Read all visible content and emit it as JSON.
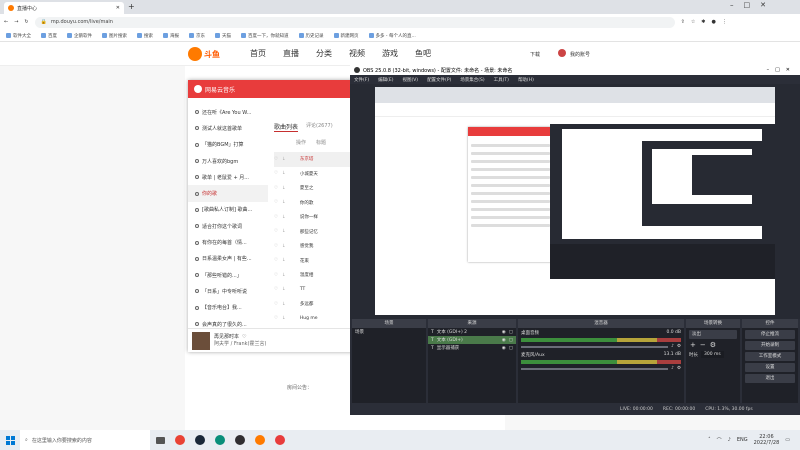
{
  "browser": {
    "tab_title": "直播中心",
    "url": "mp.douyu.com/live/main",
    "bookmarks": [
      "软件大全",
      "百度",
      "企鹅软件",
      "图片搜索",
      "搜索",
      "海报",
      "京东",
      "天猫",
      "百度一下，你就知道",
      "历史记录",
      "新建网页",
      "多多 - 每个人的直..."
    ]
  },
  "douyu": {
    "logo_text": "斗鱼",
    "nav": [
      "首页",
      "直播",
      "分类",
      "视频",
      "游戏",
      "鱼吧"
    ],
    "download": "下载",
    "user": "我的账号"
  },
  "netease": {
    "title": "网易云音乐",
    "playlists": [
      "还在听《Are You W...",
      "测试人就这首歌单",
      "「猫的BGM」打算",
      "万人喜欢的bgm",
      "歌单 | 老鼠爱 + 月...",
      "你的歌",
      "[歌曲私人订制] 歌曲...",
      "适合打你这个歌词",
      "有你在的每首（情...",
      "日系温柔女声 | 有些...",
      "「那些听错的...」",
      "「日系」中专听听说",
      "【音乐电台】我...",
      "会声真的了很久的..."
    ],
    "selected_index": 5,
    "list_tab": "歌曲列表",
    "comment_tab": "评论(2677)",
    "col_action": "操作",
    "col_title": "标题",
    "song_titles": [
      "东京塔",
      "小城夏天",
      "夏至之",
      "你的歌",
      "说你一样",
      "那些记忆",
      "感觉我",
      "花束",
      "温度相",
      "TT",
      "多远都",
      "Hug me"
    ],
    "now_playing": "再见那时本",
    "now_artist": "阿夫学 / Frank(霍兰言)"
  },
  "obs": {
    "title": "OBS 25.0.8 (32-bit, windows) - 配置文件: 未命名 - 场景: 未命名",
    "menu": [
      "文件(F)",
      "编辑(E)",
      "视图(V)",
      "配置文件(P)",
      "场景集合(S)",
      "工具(T)",
      "帮助(H)"
    ],
    "docks": {
      "scenes": "场景",
      "sources": "来源",
      "mixer": "混音器",
      "transitions": "场景转换",
      "controls": "控件"
    },
    "scene_item": "场景",
    "sources": [
      {
        "name": "文本 (GDI+) 2",
        "selected": false
      },
      {
        "name": "文本 (GDI+)",
        "selected": true
      },
      {
        "name": "显示器捕获",
        "selected": false
      }
    ],
    "mixer": [
      {
        "name": "桌面音频",
        "db": "0.0 dB"
      },
      {
        "name": "麦克风/Aux",
        "db": "13.1 dB"
      }
    ],
    "transition_label": "淡出",
    "duration_label": "时长",
    "duration_value": "300 ms",
    "controls": [
      "停止推流",
      "开始录制",
      "工作室模式",
      "设置",
      "退出"
    ],
    "status": {
      "live": "LIVE: 00:00:00",
      "rec": "REC: 00:00:00",
      "cpu": "CPU: 1.3%, 30.00 fps"
    }
  },
  "page_labels": {
    "room_label": "房间公告："
  },
  "taskbar": {
    "search_placeholder": "在这里输入你要搜索的内容",
    "lang": "ENG",
    "time": "22:06",
    "date": "2022/7/28"
  },
  "colors": {
    "netease_red": "#e83c3c",
    "douyu_orange": "#ff7a00",
    "obs_bg": "#272a33"
  }
}
